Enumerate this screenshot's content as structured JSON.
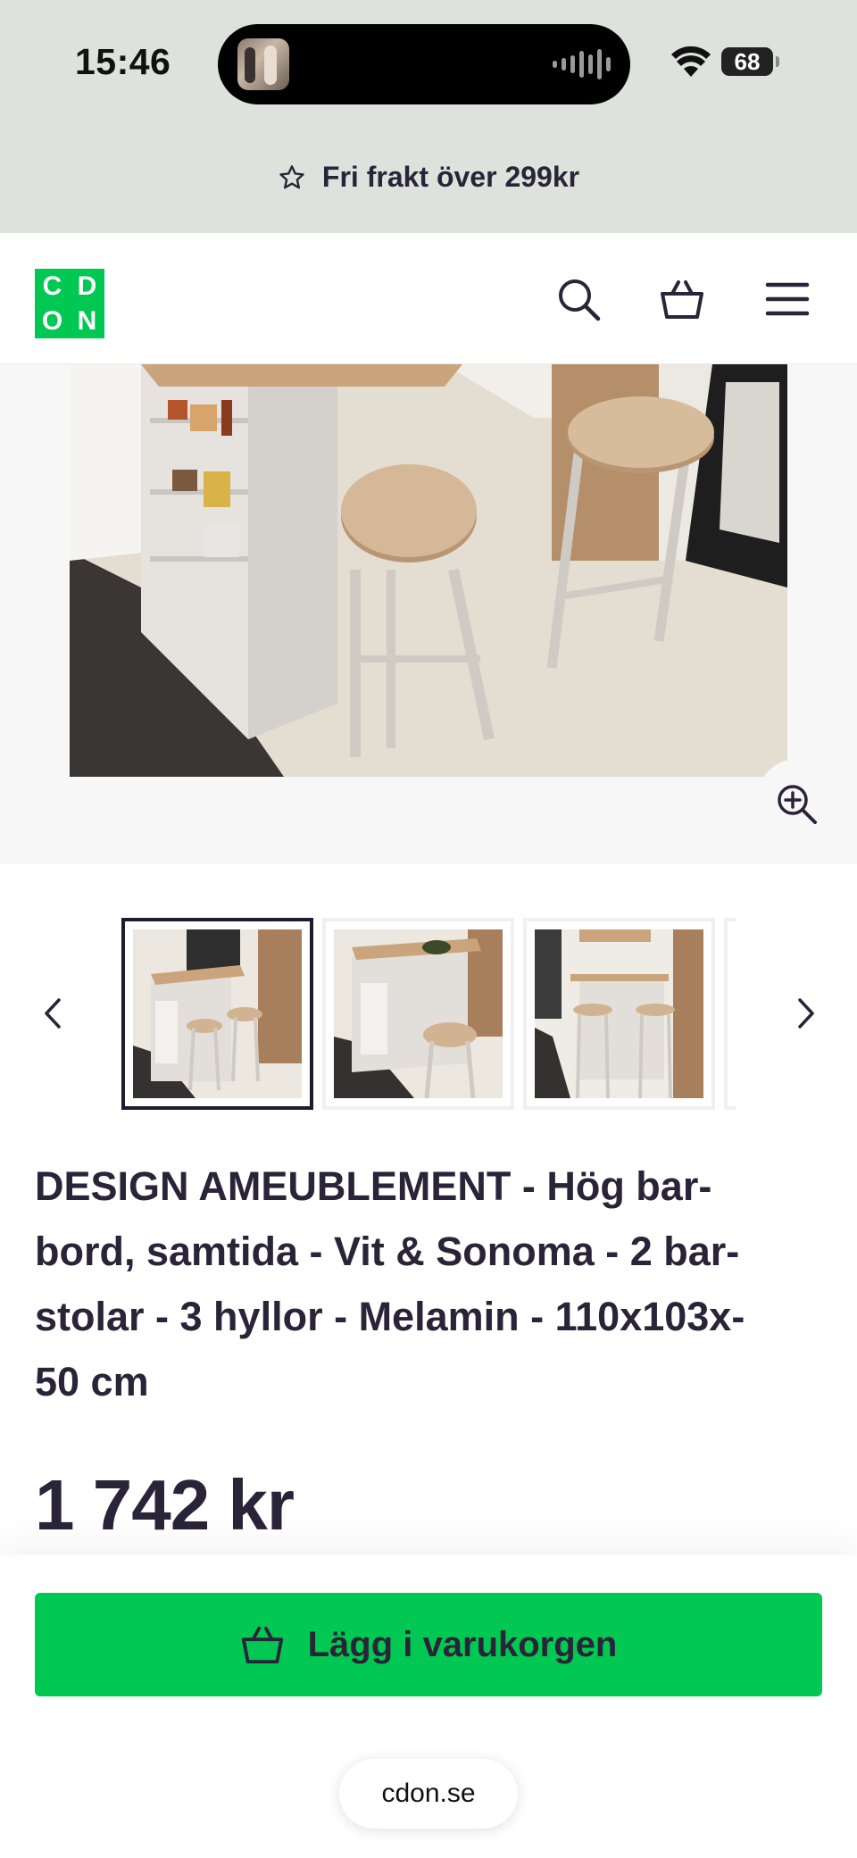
{
  "status_bar": {
    "time": "15:46",
    "battery": "68"
  },
  "promo": {
    "text": "Fri frakt över 299kr",
    "icon": "star-icon"
  },
  "header": {
    "logo_letters": [
      "C",
      "D",
      "O",
      "N"
    ],
    "icons": [
      "search-icon",
      "basket-icon",
      "menu-icon"
    ],
    "brand_color": "#00c853"
  },
  "gallery": {
    "thumbnail_count": 4,
    "active_index": 0,
    "prev_icon": "chevron-left-icon",
    "next_icon": "chevron-right-icon",
    "zoom_icon": "zoom-in-icon"
  },
  "product": {
    "title": "DESIGN AMEUBLEMENT - Hög bar-bord, samtida - Vit & Sonoma - 2 bar-stolar - 3 hyllor - Melamin - 110x103x-50 cm",
    "title_lines": [
      "DESIGN AMEUBLEMENT - Hög bar-",
      "bord, samtida - Vit & Sonoma - 2 bar-",
      "stolar - 3 hyllor - Melamin - 110x103x-",
      "50 cm"
    ],
    "price": "1 742 kr"
  },
  "cart": {
    "label": "Lägg i varukorgen",
    "icon": "basket-icon"
  },
  "browser": {
    "url": "cdon.se"
  }
}
